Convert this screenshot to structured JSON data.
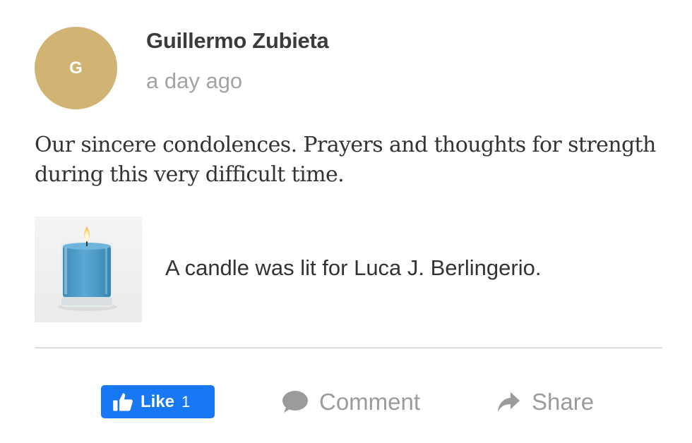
{
  "post": {
    "avatar_initial": "G",
    "author_name": "Guillermo Zubieta",
    "timestamp": "a day ago",
    "message": "Our sincere condolences. Prayers and thoughts for strength during this very difficult time."
  },
  "candle": {
    "text": "A candle was lit for Luca J. Berlingerio.",
    "candle_color": "#4a9cc9"
  },
  "actions": {
    "like_label": "Like",
    "like_count": "1",
    "comment_label": "Comment",
    "share_label": "Share"
  },
  "colors": {
    "avatar_bg": "#d1b473",
    "like_bg": "#1877f2",
    "muted_text": "#9b9b9b"
  }
}
